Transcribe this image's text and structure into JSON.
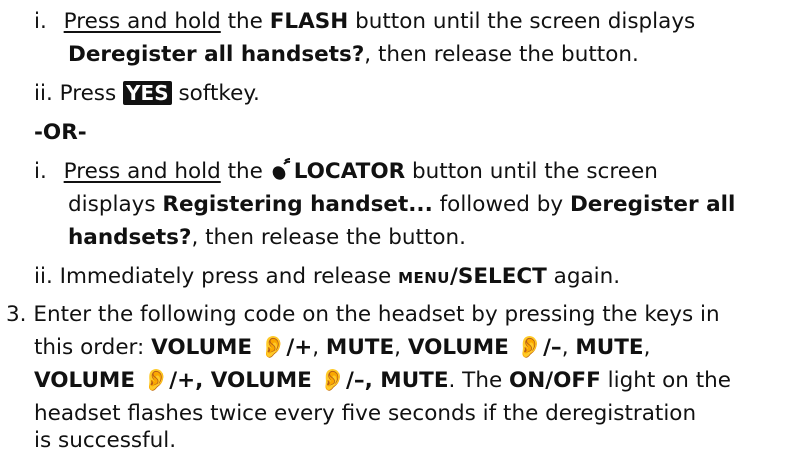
{
  "step_i_a": {
    "num": "i.",
    "l1_a": "Press and hold",
    "l1_b": " the ",
    "l1_c": "FLASH",
    "l1_d": " button until the screen displays",
    "l2_a": "Deregister all handsets?",
    "l2_b": ", then release the button."
  },
  "step_ii_a": {
    "num": "ii.",
    "a": "Press ",
    "key": "YES",
    "b": " softkey."
  },
  "or_label": "-OR-",
  "step_i_b": {
    "num": "i.",
    "l1_a": "Press and hold",
    "l1_b": " the ",
    "l1_c": "LOCATOR",
    "l1_d": " button until the screen",
    "l2_a": "displays ",
    "l2_b": "Registering handset...",
    "l2_c": " followed by ",
    "l2_d": "Deregister all",
    "l3_a": "handsets?",
    "l3_b": ", then release the button."
  },
  "step_ii_b": {
    "num": "ii.",
    "a": "Immediately press and release ",
    "menu": "MENU",
    "sel": "/SELECT",
    "b": " again."
  },
  "step_3": {
    "num": "3.",
    "l1": "Enter the following code on the headset by pressing the keys in",
    "l2_a": "this order: ",
    "l2_b": "VOLUME 👂/+",
    "l2_c": ", ",
    "l2_d": "MUTE",
    "l2_e": ", ",
    "l2_f": "VOLUME 👂/–",
    "l2_g": ", ",
    "l2_h": "MUTE",
    "l2_i": ",",
    "l3_a": "VOLUME 👂/+, VOLUME 👂/–, MUTE",
    "l3_b": ". The ",
    "l3_c": "ON/OFF",
    "l3_d": " light on the",
    "l4": "headset flashes twice every five seconds if the deregistration",
    "l5": "is successful."
  },
  "icons": {
    "locator": "locator-icon"
  }
}
